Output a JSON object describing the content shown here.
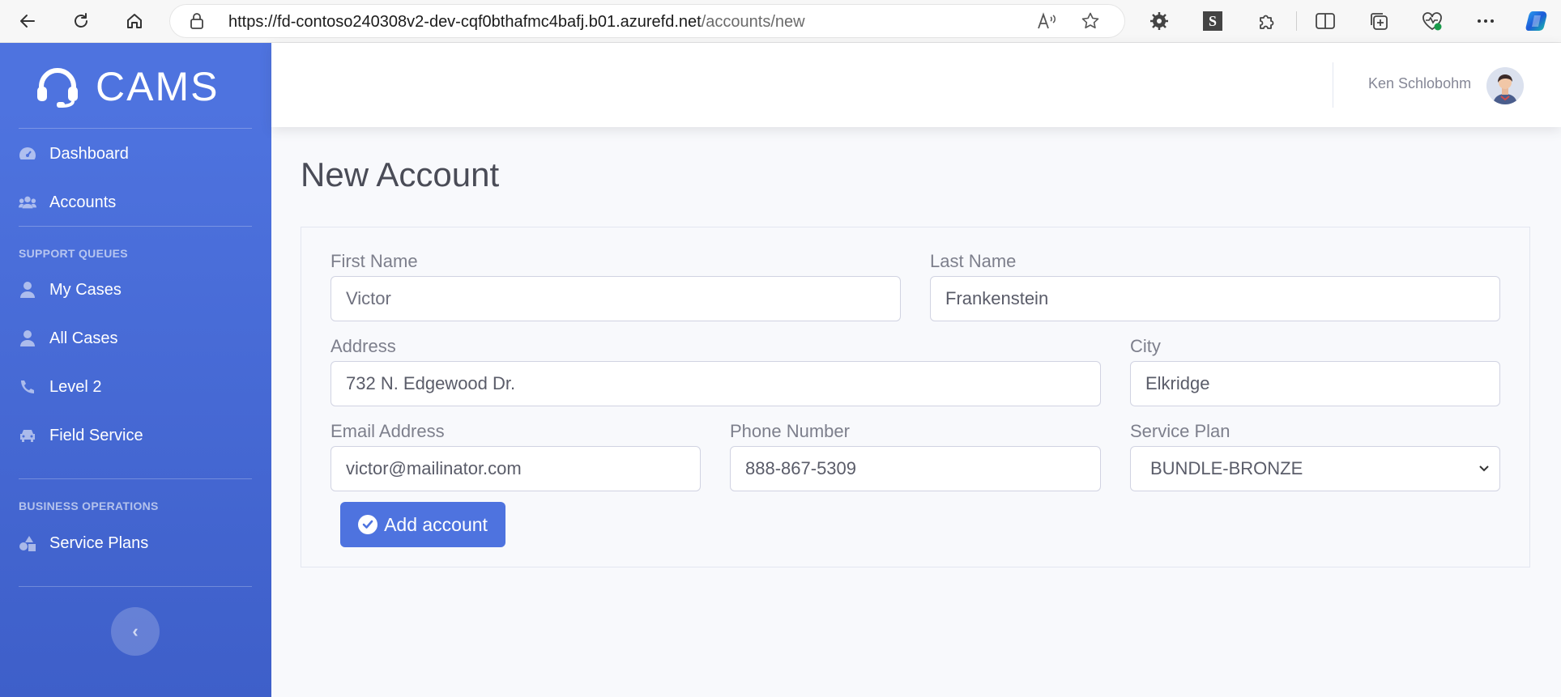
{
  "browser": {
    "url_host": "https://fd-contoso240308v2-dev-cqf0bthafmc4bafj.b01.azurefd.net",
    "url_path": "/accounts/new",
    "icons": [
      "back-arrow-icon",
      "refresh-icon",
      "home-icon",
      "lock-icon",
      "read-aloud-icon",
      "favorite-star-icon",
      "extension-gear-icon",
      "s-extension-icon",
      "puzzle-icon",
      "split-screen-icon",
      "collections-icon",
      "browser-essentials-icon",
      "more-icon",
      "copilot-icon"
    ]
  },
  "sidebar": {
    "brand": "CAMS",
    "items_top": [
      {
        "label": "Dashboard",
        "icon": "dashboard-gauge-icon"
      },
      {
        "label": "Accounts",
        "icon": "users-icon"
      }
    ],
    "support_heading": "SUPPORT QUEUES",
    "items_support": [
      {
        "label": "My Cases",
        "icon": "user-icon"
      },
      {
        "label": "All Cases",
        "icon": "user-icon"
      },
      {
        "label": "Level 2",
        "icon": "phone-icon"
      },
      {
        "label": "Field Service",
        "icon": "car-icon"
      }
    ],
    "business_heading": "BUSINESS OPERATIONS",
    "items_business": [
      {
        "label": "Service Plans",
        "icon": "shapes-icon"
      }
    ],
    "collapse_symbol": "‹"
  },
  "topbar": {
    "user_name": "Ken Schlobohm"
  },
  "page": {
    "title": "New Account"
  },
  "form": {
    "first_name": {
      "label": "First Name",
      "value": "Victor"
    },
    "last_name": {
      "label": "Last Name",
      "value": "Frankenstein"
    },
    "address": {
      "label": "Address",
      "value": "732 N. Edgewood Dr."
    },
    "city": {
      "label": "City",
      "value": "Elkridge"
    },
    "email": {
      "label": "Email Address",
      "value": "victor@mailinator.com"
    },
    "phone": {
      "label": "Phone Number",
      "value": "888-867-5309"
    },
    "service_plan": {
      "label": "Service Plan",
      "value": "BUNDLE-BRONZE"
    },
    "submit_label": "Add account"
  },
  "colors": {
    "primary": "#4e73df",
    "sidebar_dark": "#3e5fc9",
    "text_muted": "#858796"
  }
}
